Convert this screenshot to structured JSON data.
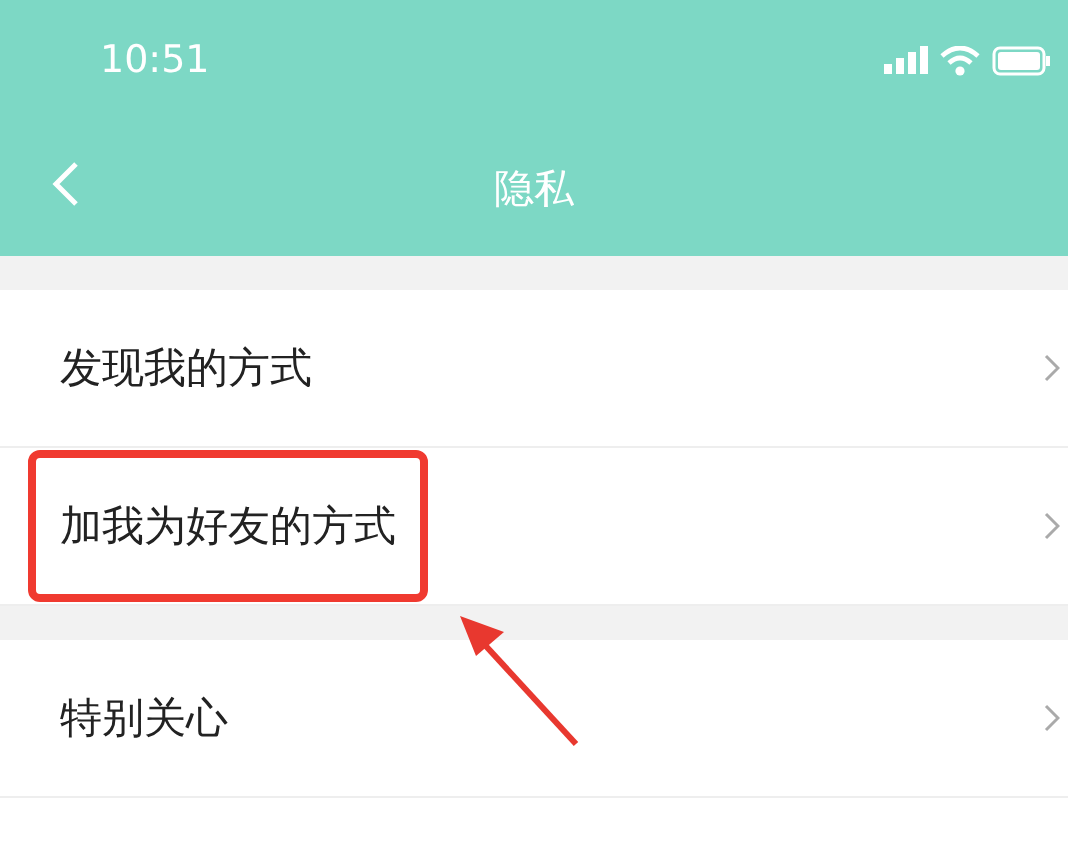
{
  "status_bar": {
    "time": "10:51"
  },
  "nav_bar": {
    "title": "隐私"
  },
  "sections": [
    {
      "items": [
        {
          "label": "发现我的方式",
          "highlighted": false
        },
        {
          "label": "加我为好友的方式",
          "highlighted": true
        }
      ]
    },
    {
      "items": [
        {
          "label": "特别关心",
          "highlighted": false
        }
      ]
    }
  ]
}
